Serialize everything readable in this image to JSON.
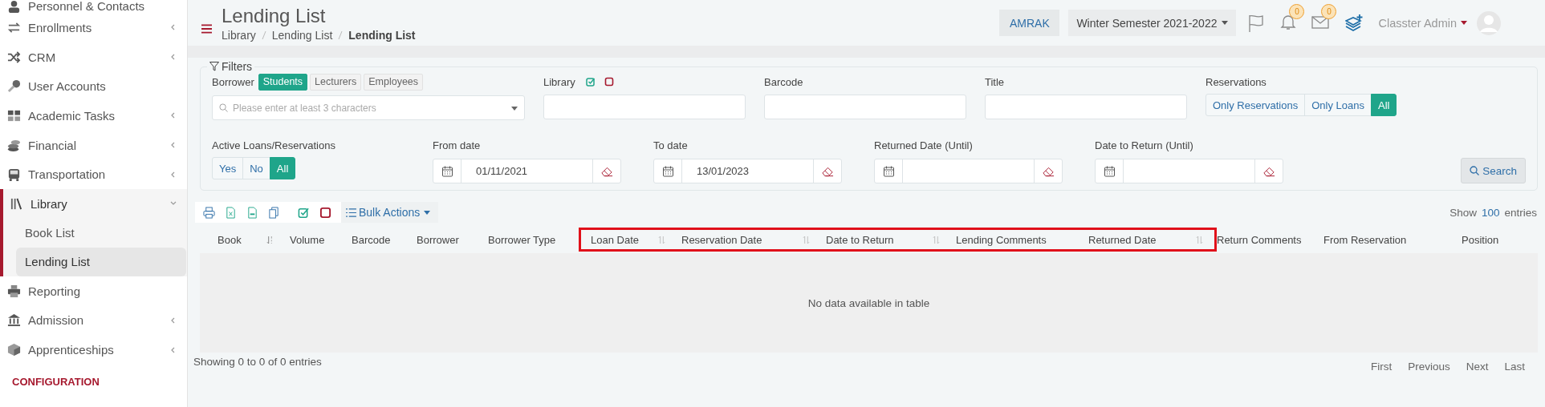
{
  "sidebar": {
    "items": [
      {
        "label": "Personnel & Contacts",
        "has_children": false,
        "expanded": false
      },
      {
        "label": "Enrollments",
        "has_children": true,
        "expanded": false
      },
      {
        "label": "CRM",
        "has_children": true,
        "expanded": false
      },
      {
        "label": "User Accounts",
        "has_children": false,
        "expanded": false
      },
      {
        "label": "Academic Tasks",
        "has_children": true,
        "expanded": false
      },
      {
        "label": "Financial",
        "has_children": true,
        "expanded": false
      },
      {
        "label": "Transportation",
        "has_children": true,
        "expanded": false
      },
      {
        "label": "Library",
        "has_children": true,
        "expanded": true,
        "children": [
          {
            "label": "Book List",
            "selected": false
          },
          {
            "label": "Lending List",
            "selected": true
          }
        ]
      },
      {
        "label": "Reporting",
        "has_children": false,
        "expanded": false
      },
      {
        "label": "Admission",
        "has_children": true,
        "expanded": false
      },
      {
        "label": "Apprenticeships",
        "has_children": true,
        "expanded": false
      }
    ],
    "section": "CONFIGURATION"
  },
  "header": {
    "title": "Lending List",
    "breadcrumb": [
      {
        "label": "Library",
        "current": false
      },
      {
        "label": "Lending List",
        "current": false
      },
      {
        "label": "Lending List",
        "current": true
      }
    ],
    "institution": "AMRAK",
    "semester": "Winter Semester 2021-2022",
    "notifications": "0",
    "messages": "0",
    "user": "Classter Admin"
  },
  "filters": {
    "title": "Filters",
    "borrower": {
      "label": "Borrower",
      "options": [
        {
          "label": "Students",
          "selected": true
        },
        {
          "label": "Lecturers",
          "selected": false
        },
        {
          "label": "Employees",
          "selected": false
        }
      ],
      "placeholder": "Please enter at least 3 characters"
    },
    "library": {
      "label": "Library"
    },
    "barcode": {
      "label": "Barcode"
    },
    "title_field": {
      "label": "Title"
    },
    "reservations": {
      "label": "Reservations",
      "options": [
        {
          "label": "Only Reservations",
          "selected": false
        },
        {
          "label": "Only Loans",
          "selected": false
        },
        {
          "label": "All",
          "selected": true
        }
      ]
    },
    "active": {
      "label": "Active Loans/Reservations",
      "options": [
        {
          "label": "Yes",
          "selected": false
        },
        {
          "label": "No",
          "selected": false
        },
        {
          "label": "All",
          "selected": true
        }
      ]
    },
    "dates": [
      {
        "label": "From date",
        "value": "01/11/2021"
      },
      {
        "label": "To date",
        "value": "13/01/2023"
      },
      {
        "label": "Returned Date (Until)"
      },
      {
        "label": "Date to Return (Until)"
      }
    ],
    "search": "Search"
  },
  "toolbar": {
    "bulk_actions": "Bulk Actions",
    "show": "Show",
    "entries_value": "100",
    "entries": "entries"
  },
  "table": {
    "columns": [
      {
        "label": "Book",
        "sortable": true,
        "sorted": true,
        "highlighted": false
      },
      {
        "label": "Volume",
        "highlighted": false
      },
      {
        "label": "Barcode",
        "highlighted": false
      },
      {
        "label": "Borrower",
        "highlighted": false
      },
      {
        "label": "Borrower Type",
        "highlighted": false
      },
      {
        "label": "Loan Date",
        "sortable": true,
        "sorted": false,
        "highlighted": true
      },
      {
        "label": "Reservation Date",
        "sortable": true,
        "sorted": false,
        "highlighted": true
      },
      {
        "label": "Date to Return",
        "sortable": true,
        "sorted": false,
        "highlighted": true
      },
      {
        "label": "Lending Comments",
        "highlighted": true
      },
      {
        "label": "Returned Date",
        "sortable": true,
        "sorted": false,
        "highlighted": true
      },
      {
        "label": "Return Comments",
        "highlighted": false
      },
      {
        "label": "From Reservation",
        "highlighted": false
      },
      {
        "label": "Position",
        "highlighted": false
      }
    ],
    "empty": "No data available in table",
    "info": "Showing 0 to 0 of 0 entries",
    "pagination": [
      "First",
      "Previous",
      "Next",
      "Last"
    ]
  }
}
